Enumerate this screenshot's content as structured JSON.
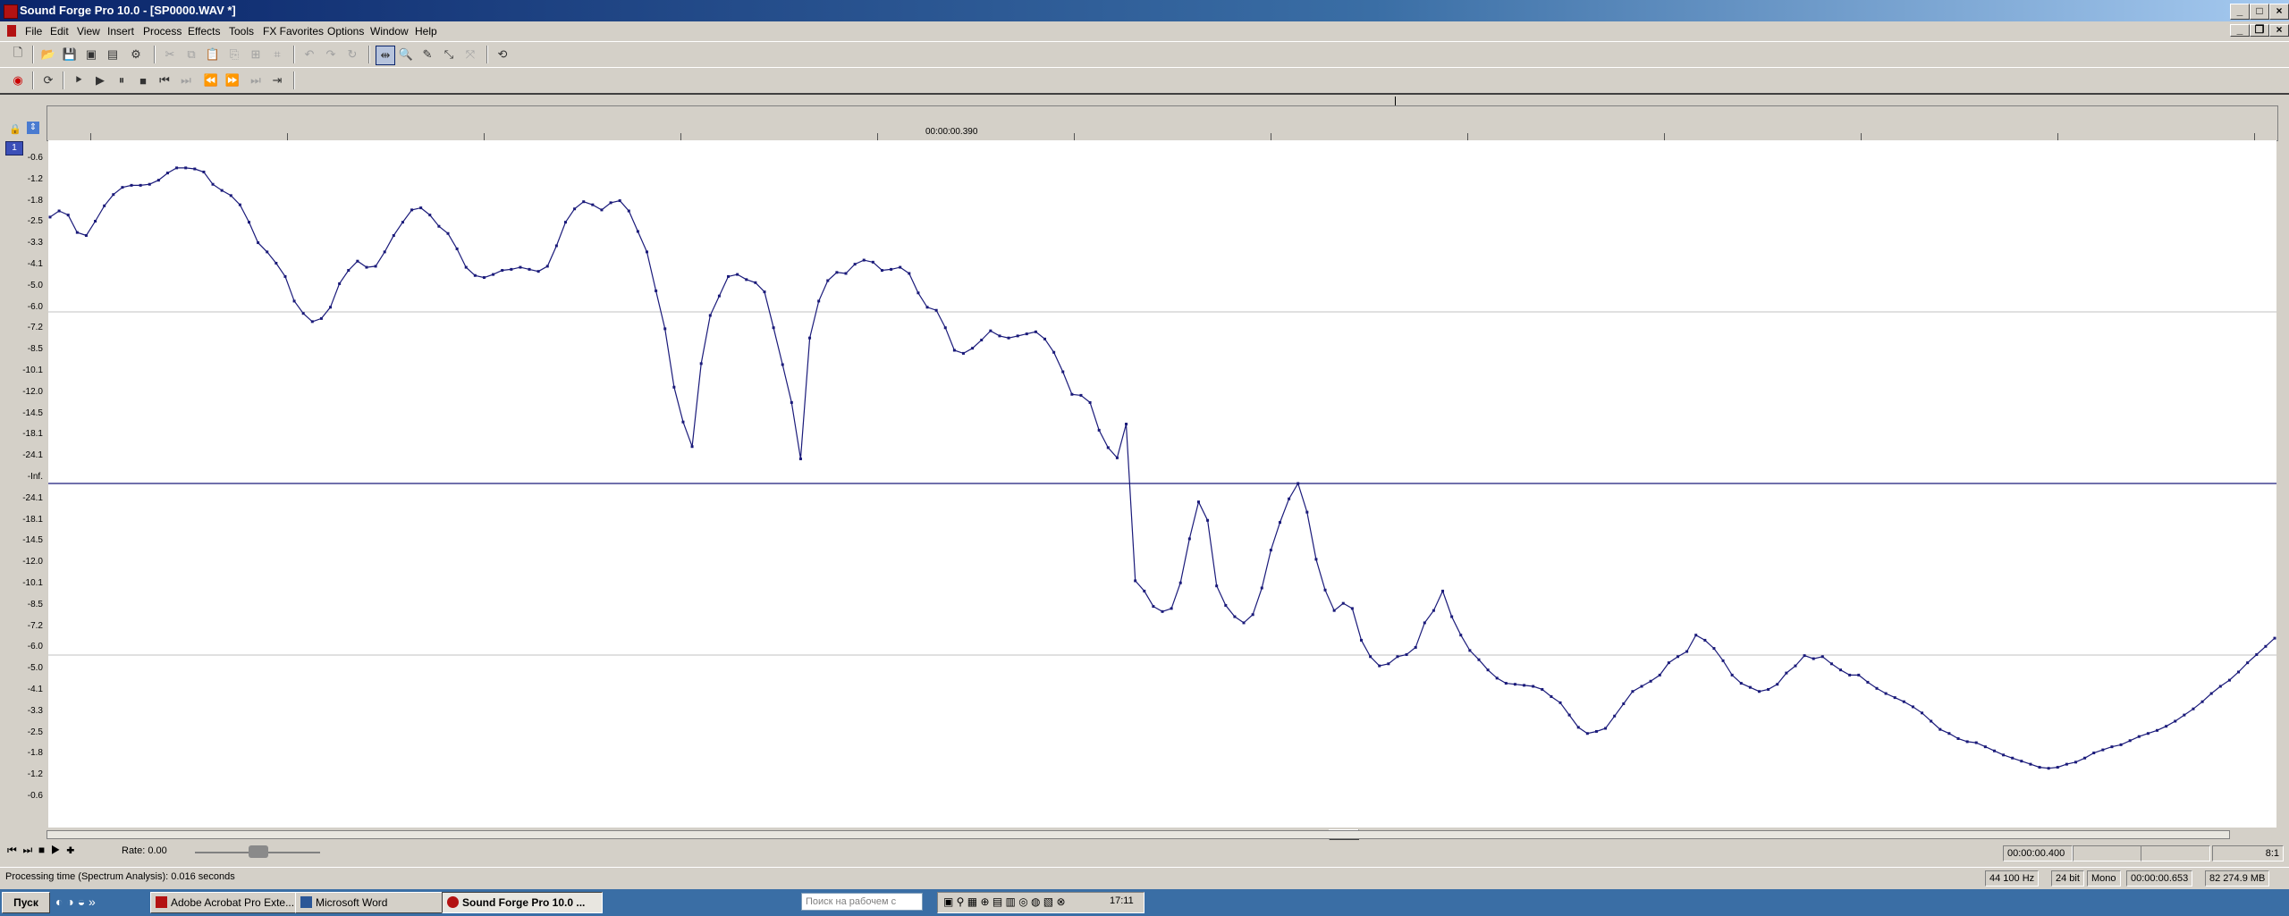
{
  "window": {
    "title": "Sound Forge Pro 10.0 - [SP0000.WAV *]",
    "controls": {
      "minimize": "_",
      "maximize": "□",
      "close": "×"
    }
  },
  "menu": [
    "File",
    "Edit",
    "View",
    "Insert",
    "Process",
    "Effects",
    "Tools",
    "FX Favorites",
    "Options",
    "Window",
    "Help"
  ],
  "toolbar": {
    "row1_icons": [
      "new-icon",
      "open-icon",
      "save-icon",
      "save-as-icon",
      "render-icon",
      "properties-icon",
      "cut-icon",
      "copy-icon",
      "paste-icon",
      "paste-special-icon",
      "mix-icon",
      "crop-icon",
      "undo-icon",
      "redo-icon",
      "repeat-icon",
      "edit-tool-icon",
      "magnify-tool-icon",
      "pencil-tool-icon",
      "envelope-tool-icon",
      "event-tool-icon",
      "help-icon"
    ],
    "row2_icons": [
      "record-icon",
      "loop-icon",
      "play-all-icon",
      "play-icon",
      "pause-icon",
      "stop-icon",
      "go-start-icon",
      "go-end-icon",
      "rewind-icon",
      "forward-icon",
      "prev-marker-icon",
      "next-marker-icon"
    ]
  },
  "ruler": {
    "cursor_time": "00:00:00.390"
  },
  "channel": {
    "number": "1"
  },
  "y_axis_labels": [
    "-0.6",
    "-1.2",
    "-1.8",
    "-2.5",
    "-3.3",
    "-4.1",
    "-5.0",
    "-6.0",
    "-7.2",
    "-8.5",
    "-10.1",
    "-12.0",
    "-14.5",
    "-18.1",
    "-24.1",
    "-Inf.",
    "-24.1",
    "-18.1",
    "-14.5",
    "-12.0",
    "-10.1",
    "-8.5",
    "-7.2",
    "-6.0",
    "-5.0",
    "-4.1",
    "-3.3",
    "-2.5",
    "-1.8",
    "-1.2",
    "-0.6"
  ],
  "waveform": {
    "color": "#1a1a7a",
    "points_db_signed": [
      -6.0,
      -5.4,
      -5.8,
      -7.5,
      -7.8,
      -6.4,
      -4.9,
      -3.8,
      -3.1,
      -2.9,
      -2.9,
      -2.8,
      -2.4,
      -1.7,
      -1.2,
      -1.2,
      -1.3,
      -1.6,
      -2.8,
      -3.4,
      -3.9,
      -4.8,
      -6.5,
      -8.5,
      -9.4,
      -10.5,
      -11.8,
      -14.2,
      -15.4,
      -16.2,
      -15.9,
      -14.8,
      -12.5,
      -11.2,
      -10.3,
      -10.9,
      -10.8,
      -9.4,
      -7.8,
      -6.5,
      -5.3,
      -5.1,
      -5.8,
      -6.9,
      -7.6,
      -9.1,
      -10.9,
      -11.7,
      -11.9,
      -11.6,
      -11.2,
      -11.1,
      -10.9,
      -11.1,
      -11.3,
      -10.8,
      -8.8,
      -6.5,
      -5.2,
      -4.5,
      -4.8,
      -5.3,
      -4.6,
      -4.4,
      -5.4,
      -7.4,
      -9.4,
      -13.2,
      -16.9,
      -22.6,
      -26.0,
      -28.4,
      -20.3,
      -15.6,
      -13.7,
      -11.8,
      -11.6,
      -12.1,
      -12.4,
      -13.3,
      -16.8,
      -20.4,
      -24.1,
      -29.6,
      -17.8,
      -14.2,
      -12.2,
      -11.4,
      -11.5,
      -10.6,
      -10.2,
      -10.4,
      -11.2,
      -11.1,
      -10.9,
      -11.5,
      -13.4,
      -14.8,
      -15.1,
      -16.8,
      -19.0,
      -19.3,
      -18.8,
      -18.0,
      -17.1,
      -17.6,
      -17.8,
      -17.6,
      -17.4,
      -17.2,
      -17.9,
      -19.2,
      -21.1,
      -23.3,
      -23.4,
      -24.1,
      -26.8,
      -28.5,
      -29.5,
      -26.2,
      -22.5,
      -21.5,
      -20.0,
      -19.5,
      -19.8,
      -22.3,
      -26.6,
      -30.2,
      -28.4,
      -22.0,
      -20.1,
      -19.0,
      -18.4,
      -19.2,
      -21.8,
      -25.5,
      -28.2,
      -30.5,
      -32.0,
      -29.2,
      -24.6,
      -21.6,
      -19.6,
      -20.3,
      -19.8,
      -16.7,
      -15.1,
      -14.2,
      -14.4,
      -15.1,
      -15.3,
      -16.0,
      -18.4,
      -19.6,
      -21.5,
      -19.0,
      -17.2,
      -15.7,
      -14.8,
      -13.8,
      -13.0,
      -12.5,
      -12.4,
      -12.3,
      -12.2,
      -11.9,
      -11.2,
      -10.6,
      -9.4,
      -8.2,
      -7.6,
      -7.8,
      -8.1,
      -9.3,
      -10.5,
      -11.7,
      -12.2,
      -12.7,
      -13.3,
      -14.5,
      -15.1,
      -15.6,
      -17.2,
      -16.7,
      -15.9,
      -14.7,
      -13.3,
      -12.5,
      -12.1,
      -11.7,
      -11.9,
      -12.4,
      -13.5,
      -14.2,
      -15.2,
      -14.9,
      -15.1,
      -14.4,
      -13.8,
      -13.3,
      -13.3,
      -12.6,
      -12.0,
      -11.5,
      -11.1,
      -10.7,
      -10.2,
      -9.6,
      -8.8,
      -8.0,
      -7.6,
      -7.1,
      -6.8,
      -6.7,
      -6.3,
      -5.9,
      -5.5,
      -5.2,
      -4.9,
      -4.6,
      -4.3,
      -4.2,
      -4.3,
      -4.6,
      -4.8,
      -5.2,
      -5.7,
      -6.0,
      -6.3,
      -6.5,
      -6.9,
      -7.3,
      -7.6,
      -7.9,
      -8.3,
      -8.8,
      -9.4,
      -10.0,
      -10.7,
      -11.5,
      -12.2,
      -12.8,
      -13.6,
      -14.5,
      -15.3,
      -16.1,
      -16.9
    ]
  },
  "transport": {
    "rate_label": "Rate: 0.00"
  },
  "status": {
    "left_message": "Processing time (Spectrum Analysis): 0.016 seconds",
    "sample_rate": "44 100 Hz",
    "bit_depth": "24 bit",
    "channels": "Mono",
    "length": "00:00:00.653",
    "disk_free": "82 274.9 MB",
    "selection_start": "00:00:00.400",
    "zoom_ratio": "8:1"
  },
  "taskbar": {
    "start_label": "Пуск",
    "tasks": [
      {
        "label": "Adobe Acrobat Pro Exte...",
        "icon_color": "#b31212"
      },
      {
        "label": "Microsoft Word",
        "icon_color": "#2b5797"
      },
      {
        "label": "Sound Forge Pro 10.0 ...",
        "icon_color": "#b31212",
        "active": true
      }
    ],
    "search_placeholder": "Поиск на рабочем с",
    "clock": "17:11"
  }
}
